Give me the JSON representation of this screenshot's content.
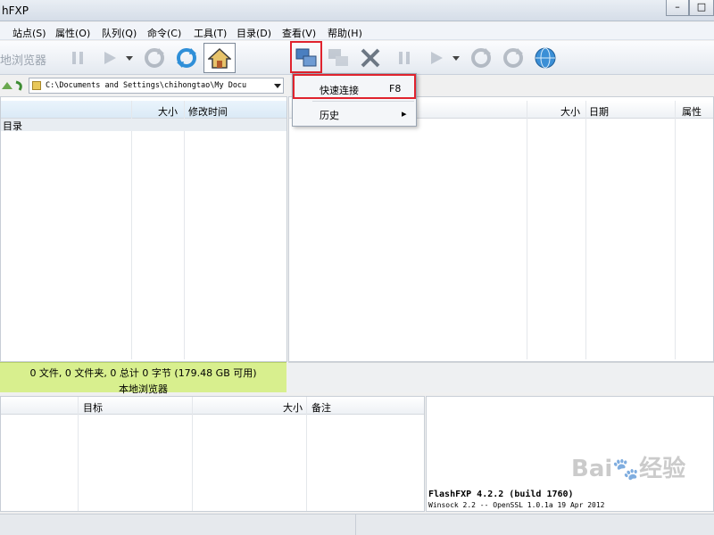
{
  "window": {
    "title": "hFXP"
  },
  "menu": [
    {
      "label": "站点(S)"
    },
    {
      "label": "属性(O)"
    },
    {
      "label": "队列(Q)"
    },
    {
      "label": "命令(C)"
    },
    {
      "label": "工具(T)"
    },
    {
      "label": "目录(D)"
    },
    {
      "label": "查看(V)"
    },
    {
      "label": "帮助(H)"
    }
  ],
  "local_toolbar": {
    "label": "地浏览器"
  },
  "local_path": {
    "value": "C:\\Documents and Settings\\chihongtao\\My Docu"
  },
  "local_list": {
    "columns": [
      "大小",
      "修改时间"
    ],
    "rows": [
      {
        "name": "目录"
      }
    ]
  },
  "remote_list": {
    "columns": [
      "大小",
      "日期",
      "属性"
    ]
  },
  "local_status": {
    "line1": "0 文件, 0 文件夹, 0 总计 0 字节 (179.48 GB 可用)",
    "line2": "本地浏览器"
  },
  "dropdown": {
    "items": [
      {
        "label": "快速连接",
        "shortcut": "F8"
      },
      {
        "label": "历史",
        "submenu_arrow": "▸"
      }
    ]
  },
  "queue": {
    "columns": [
      "目标",
      "大小",
      "备注"
    ]
  },
  "log": {
    "line1": "FlashFXP 4.2.2 (build 1760)",
    "line2": "Winsock 2.2 -- OpenSSL 1.0.1a 19 Apr 2012"
  },
  "watermark": {
    "text": "Bai",
    "text2": "经验"
  },
  "colors": {
    "highlight": "#e0232e",
    "status_local": "#d8ef8e"
  }
}
